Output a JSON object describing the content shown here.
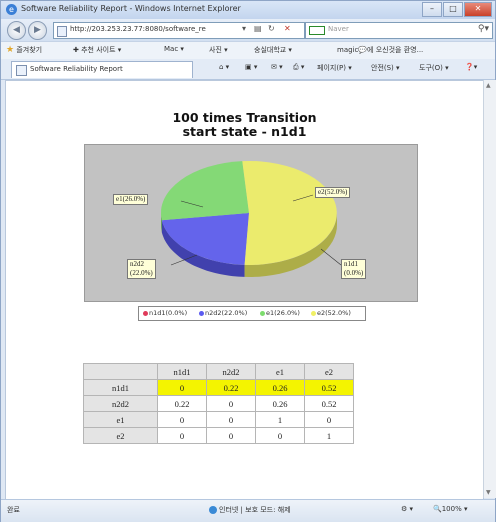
{
  "window": {
    "title": "Software Reliability Report - Windows Internet Explorer"
  },
  "address_bar": {
    "url": "http://203.253.23.77:8080/software_re",
    "search_placeholder": "Naver"
  },
  "favorites_bar": {
    "items": [
      "즐겨찾기",
      "추천 사이트 ▾",
      "Mac ▾",
      "사진 ▾",
      "숭실대학교 ▾",
      "magic💬에 오신것을 환영..."
    ]
  },
  "tab": {
    "label": "Software Reliability Report"
  },
  "command_bar": {
    "items": [
      "페이지(P) ▾",
      "안전(S) ▾",
      "도구(O) ▾"
    ]
  },
  "chart_data": {
    "type": "pie",
    "title": "100 times Transition",
    "subtitle": "start state - n1d1",
    "slices": [
      {
        "name": "n1d1",
        "value": 0.0,
        "label": "n1d1\n(0.0%)",
        "color": "#e03a5a"
      },
      {
        "name": "n2d2",
        "value": 22.0,
        "label": "n2d2\n(22.0%)",
        "color": "#5a5af0"
      },
      {
        "name": "e1",
        "value": 26.0,
        "label": "e1(26.0%)",
        "color": "#7ddc6e"
      },
      {
        "name": "e2",
        "value": 52.0,
        "label": "e2(52.0%)",
        "color": "#f0f064"
      }
    ],
    "legend": {
      "placement": "bottom",
      "entries": [
        "n1d1(0.0%)",
        "n2d2(22.0%)",
        "e1(26.0%)",
        "e2(52.0%)"
      ]
    }
  },
  "transition_table": {
    "columns": [
      "n1d1",
      "n2d2",
      "e1",
      "e2"
    ],
    "rows": [
      {
        "state": "n1d1",
        "values": [
          "0",
          "0.22",
          "0.26",
          "0.52"
        ]
      },
      {
        "state": "n2d2",
        "values": [
          "0.22",
          "0",
          "0.26",
          "0.52"
        ]
      },
      {
        "state": "e1",
        "values": [
          "0",
          "0",
          "1",
          "0"
        ]
      },
      {
        "state": "e2",
        "values": [
          "0",
          "0",
          "0",
          "1"
        ]
      }
    ]
  },
  "status_bar": {
    "left": "완료",
    "center": "인터넷 | 보호 모드: 해제",
    "zoom": "100%"
  }
}
